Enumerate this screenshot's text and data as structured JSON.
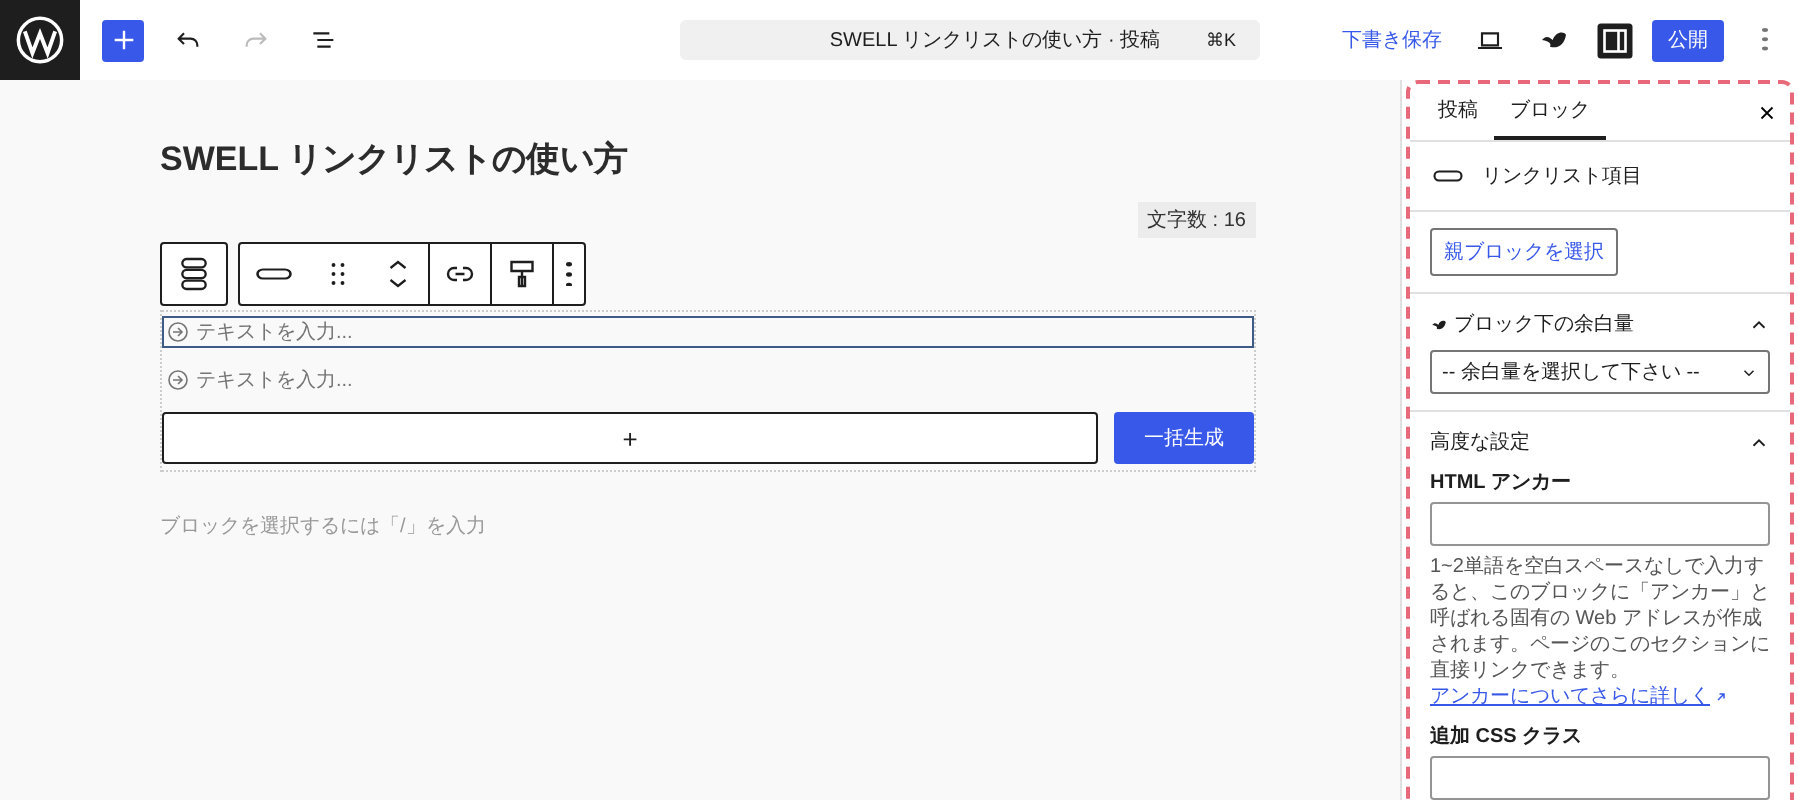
{
  "topbar": {
    "document_title": "SWELL リンクリストの使い方 · 投稿",
    "shortcut": "⌘K",
    "save_draft": "下書き保存",
    "settings_toggle": {
      "pressed": true
    },
    "publish": "公開"
  },
  "post": {
    "title": "SWELL リンクリストの使い方",
    "word_count": "文字数 : 16"
  },
  "link_list": {
    "items": [
      {
        "placeholder": "テキストを入力...",
        "selected": true
      },
      {
        "placeholder": "テキストを入力...",
        "selected": false
      }
    ],
    "add_label": "+",
    "generate_label": "一括生成"
  },
  "appender_hint": "ブロックを選択するには「/」を入力",
  "sidebar": {
    "tabs": [
      {
        "label": "投稿",
        "selected": false
      },
      {
        "label": "ブロック",
        "selected": true
      }
    ],
    "block_name": "リンクリスト項目",
    "select_parent": "親ブロックを選択",
    "panels": [
      {
        "kind": "select",
        "title": "ブロック下の余白量",
        "expanded": true,
        "value": "-- 余白量を選択して下さい --"
      },
      {
        "kind": "advanced",
        "title": "高度な設定",
        "expanded": true,
        "anchor_label": "HTML アンカー",
        "help": "1~2単語を空白スペースなしで入力すると、このブロックに「アンカー」と呼ばれる固有の Web アドレスが作成されます。ページのこのセクションに直接リンクできます。",
        "help_link": "アンカーについてさらに詳しく",
        "css_label": "追加 CSS クラス"
      }
    ]
  }
}
